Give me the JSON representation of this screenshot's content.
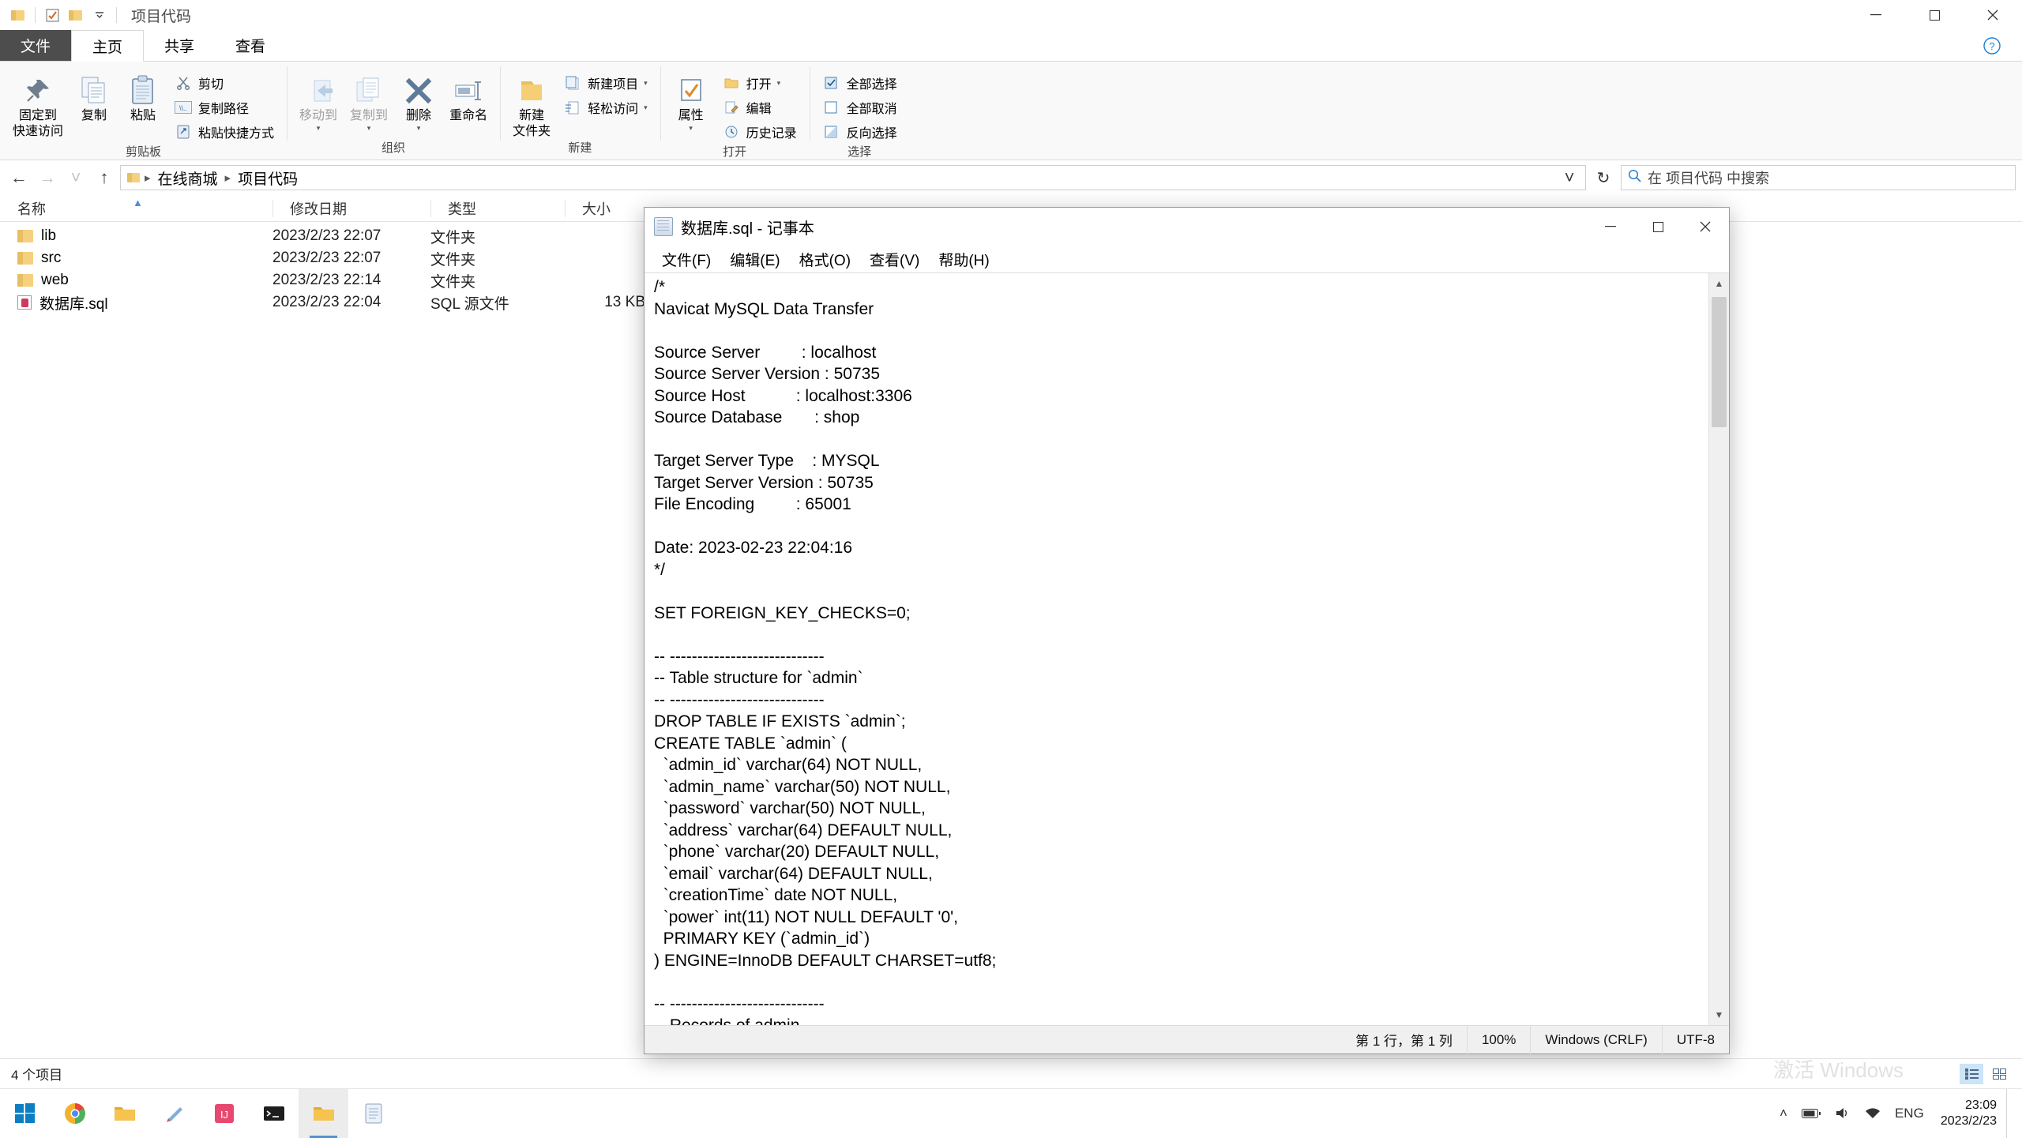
{
  "explorer": {
    "window_title": "项目代码",
    "quick_access_icons": [
      "folder-icon",
      "properties-icon",
      "new-folder-icon",
      "customize-chevron-icon"
    ],
    "caption": {
      "minimize": "—",
      "maximize": "□",
      "close": "✕"
    },
    "tabs": [
      {
        "label": "文件",
        "kind": "file"
      },
      {
        "label": "主页",
        "kind": "active"
      },
      {
        "label": "共享",
        "kind": "normal"
      },
      {
        "label": "查看",
        "kind": "normal"
      }
    ],
    "ribbon": {
      "groups": [
        {
          "label": "剪贴板",
          "big": [
            {
              "label": "固定到\n快速访问",
              "icon": "pin-icon"
            },
            {
              "label": "复制",
              "icon": "copy-icon"
            },
            {
              "label": "粘贴",
              "icon": "paste-icon"
            }
          ],
          "small": [
            {
              "label": "剪切",
              "icon": "scissors-icon"
            },
            {
              "label": "复制路径",
              "icon": "copy-path-icon"
            },
            {
              "label": "粘贴快捷方式",
              "icon": "paste-shortcut-icon"
            }
          ]
        },
        {
          "label": "组织",
          "big": [
            {
              "label": "移动到",
              "icon": "move-to-icon",
              "dim": true,
              "caret": true
            },
            {
              "label": "复制到",
              "icon": "copy-to-icon",
              "dim": true,
              "caret": true
            },
            {
              "label": "删除",
              "icon": "delete-icon",
              "caret": true
            },
            {
              "label": "重命名",
              "icon": "rename-icon"
            }
          ],
          "small": []
        },
        {
          "label": "新建",
          "big": [
            {
              "label": "新建\n文件夹",
              "icon": "new-folder-icon"
            }
          ],
          "small": [
            {
              "label": "新建项目",
              "icon": "new-item-icon",
              "caret": true
            },
            {
              "label": "轻松访问",
              "icon": "easy-access-icon",
              "caret": true
            }
          ]
        },
        {
          "label": "打开",
          "big": [
            {
              "label": "属性",
              "icon": "properties-icon",
              "caret": true
            }
          ],
          "small": [
            {
              "label": "打开",
              "icon": "open-icon",
              "caret": true
            },
            {
              "label": "编辑",
              "icon": "edit-icon"
            },
            {
              "label": "历史记录",
              "icon": "history-icon"
            }
          ]
        },
        {
          "label": "选择",
          "big": [],
          "small": [
            {
              "label": "全部选择",
              "icon": "select-all-icon"
            },
            {
              "label": "全部取消",
              "icon": "select-none-icon"
            },
            {
              "label": "反向选择",
              "icon": "invert-selection-icon"
            }
          ]
        }
      ]
    },
    "nav": {
      "back": "←",
      "forward": "→",
      "recent": "˅",
      "up": "↑"
    },
    "breadcrumbs": [
      "在线商城",
      "项目代码"
    ],
    "address_chevron": "˅",
    "refresh": "↻",
    "search_placeholder": "在 项目代码 中搜索",
    "columns": [
      {
        "label": "名称",
        "key": "name"
      },
      {
        "label": "修改日期",
        "key": "date"
      },
      {
        "label": "类型",
        "key": "type"
      },
      {
        "label": "大小",
        "key": "size"
      }
    ],
    "files": [
      {
        "name": "lib",
        "date": "2023/2/23 22:07",
        "type": "文件夹",
        "size": "",
        "icon": "folder-icon"
      },
      {
        "name": "src",
        "date": "2023/2/23 22:07",
        "type": "文件夹",
        "size": "",
        "icon": "folder-icon"
      },
      {
        "name": "web",
        "date": "2023/2/23 22:14",
        "type": "文件夹",
        "size": "",
        "icon": "folder-icon"
      },
      {
        "name": "数据库.sql",
        "date": "2023/2/23 22:04",
        "type": "SQL 源文件",
        "size": "13 KB",
        "icon": "sql-file-icon"
      }
    ],
    "status": "4 个项目"
  },
  "notepad": {
    "title": "数据库.sql - 记事本",
    "caption": {
      "minimize": "—",
      "maximize": "□",
      "close": "✕"
    },
    "menu": [
      "文件(F)",
      "编辑(E)",
      "格式(O)",
      "查看(V)",
      "帮助(H)"
    ],
    "content": "/*\nNavicat MySQL Data Transfer\n\nSource Server         : localhost\nSource Server Version : 50735\nSource Host           : localhost:3306\nSource Database       : shop\n\nTarget Server Type    : MYSQL\nTarget Server Version : 50735\nFile Encoding         : 65001\n\nDate: 2023-02-23 22:04:16\n*/\n\nSET FOREIGN_KEY_CHECKS=0;\n\n-- ----------------------------\n-- Table structure for `admin`\n-- ----------------------------\nDROP TABLE IF EXISTS `admin`;\nCREATE TABLE `admin` (\n  `admin_id` varchar(64) NOT NULL,\n  `admin_name` varchar(50) NOT NULL,\n  `password` varchar(50) NOT NULL,\n  `address` varchar(64) DEFAULT NULL,\n  `phone` varchar(20) DEFAULT NULL,\n  `email` varchar(64) DEFAULT NULL,\n  `creationTime` date NOT NULL,\n  `power` int(11) NOT NULL DEFAULT '0',\n  PRIMARY KEY (`admin_id`)\n) ENGINE=InnoDB DEFAULT CHARSET=utf8;\n\n-- ----------------------------\n-- Records of admin\n-- ----------------------------",
    "status": {
      "position": "第 1 行，第 1 列",
      "zoom": "100%",
      "line_ending": "Windows (CRLF)",
      "encoding": "UTF-8"
    },
    "scrollbar": {
      "up": "▲",
      "down": "▼"
    }
  },
  "taskbar": {
    "items": [
      {
        "name": "start-button",
        "icon": "windows-logo-icon"
      },
      {
        "name": "taskbar-chrome",
        "icon": "chrome-icon"
      },
      {
        "name": "taskbar-explorer",
        "icon": "file-explorer-icon"
      },
      {
        "name": "taskbar-editor",
        "icon": "editor-icon"
      },
      {
        "name": "taskbar-idea",
        "icon": "intellij-icon"
      },
      {
        "name": "taskbar-terminal",
        "icon": "terminal-icon"
      },
      {
        "name": "taskbar-explorer-active",
        "icon": "file-explorer-icon"
      },
      {
        "name": "taskbar-notepad",
        "icon": "notepad-icon"
      }
    ],
    "tray": {
      "chevron": "˄",
      "items": [
        "battery-icon",
        "volume-icon",
        "network-icon"
      ],
      "input": "ENG"
    },
    "clock": {
      "time": "23:09",
      "date": "2023/2/23"
    }
  },
  "watermark": "激活 Windows"
}
